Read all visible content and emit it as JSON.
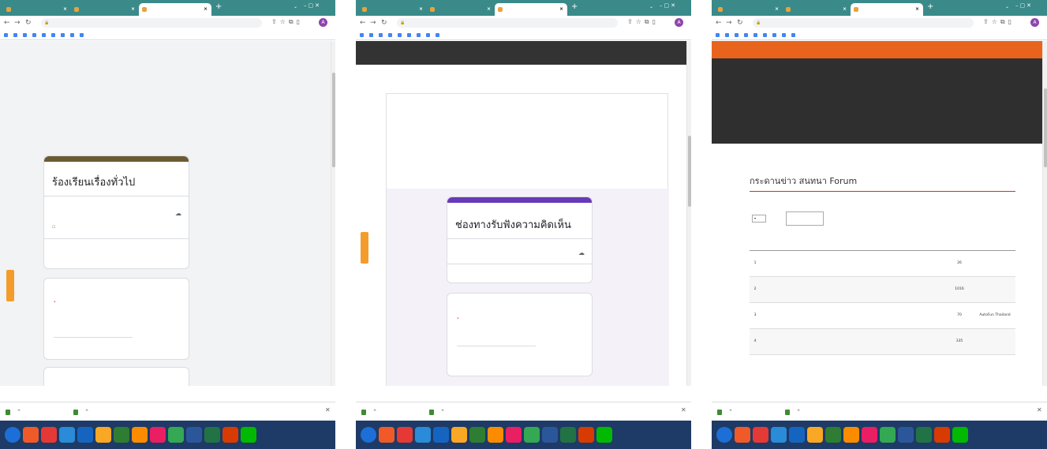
{
  "taskbar_icon_colors": [
    "#1c6fd6",
    "#f05a28",
    "#e53935",
    "#2a8bd8",
    "#1565c0",
    "#f9a825",
    "#2e7d32",
    "#fb8c00",
    "#e91e63",
    "#34a853",
    "#2b579a",
    "#217346",
    "#d83b01",
    "#00b900"
  ],
  "shot1": {
    "tabs": [
      "",
      "",
      ""
    ],
    "url": "",
    "bookmarks": [
      "",
      "",
      "",
      "",
      "",
      "",
      "",
      "",
      ""
    ],
    "header_partial": "",
    "list_lines": [
      "",
      "",
      "",
      "",
      "",
      "",
      "",
      ""
    ],
    "form": {
      "title": "ร้องเรียนเรื่องทั่วไป",
      "account": "",
      "switch_account": "",
      "not_shared": "",
      "required_note": "",
      "question": "",
      "required_mark": "*",
      "answer_placeholder": ""
    },
    "statusbar": "",
    "downloads": [
      "",
      ""
    ],
    "show_all": "",
    "tray": "",
    "clock_time": "",
    "clock_date": ""
  },
  "shot2": {
    "tabs": [
      "",
      "",
      ""
    ],
    "url": "",
    "bookmarks": [
      "",
      "",
      "",
      "",
      "",
      "",
      "",
      "",
      ""
    ],
    "menu": [
      "",
      "",
      ""
    ],
    "heading_line1": "",
    "heading_line2": "",
    "notes": [
      "",
      "",
      ""
    ],
    "form": {
      "title": "ช่องทางรับฟังความคิดเห็น",
      "account": "",
      "switch_account": "",
      "required_note": "",
      "question": "",
      "required_mark": "*",
      "answer_placeholder": ""
    },
    "downloads": [
      "",
      ""
    ],
    "show_all": "",
    "tray": "",
    "clock_time": "",
    "clock_date": ""
  },
  "shot3": {
    "tabs": [
      "",
      "",
      ""
    ],
    "url": "",
    "bookmarks": [
      "",
      "",
      "",
      "",
      "",
      "",
      "",
      "",
      ""
    ],
    "banner_text": "",
    "nav_row1": [
      "",
      "",
      "",
      "",
      "",
      ""
    ],
    "nav_row2": [
      "",
      "",
      ""
    ],
    "forum_title": "กระดานข่าว สนทนา Forum",
    "title_links": "",
    "show_label": "",
    "per_page_value": "",
    "per_page_suffix": "",
    "search_label": "",
    "columns": [
      "",
      "",
      "",
      ""
    ],
    "rows": [
      {
        "num": "1",
        "title": "",
        "meta": "",
        "date": "",
        "reads": "26",
        "replier": ""
      },
      {
        "num": "2",
        "title": "",
        "meta": "",
        "date": "",
        "reads": "1016",
        "replier": ""
      },
      {
        "num": "3",
        "title": "",
        "meta": "",
        "date": "",
        "reads": "70",
        "replier": "AutoFun Thailand"
      },
      {
        "num": "4",
        "title": "",
        "meta": "",
        "date": "",
        "reads": "335",
        "replier": ""
      }
    ],
    "downloads": [
      "",
      ""
    ],
    "show_all": "",
    "tray": "",
    "clock_time": "",
    "clock_date": ""
  }
}
